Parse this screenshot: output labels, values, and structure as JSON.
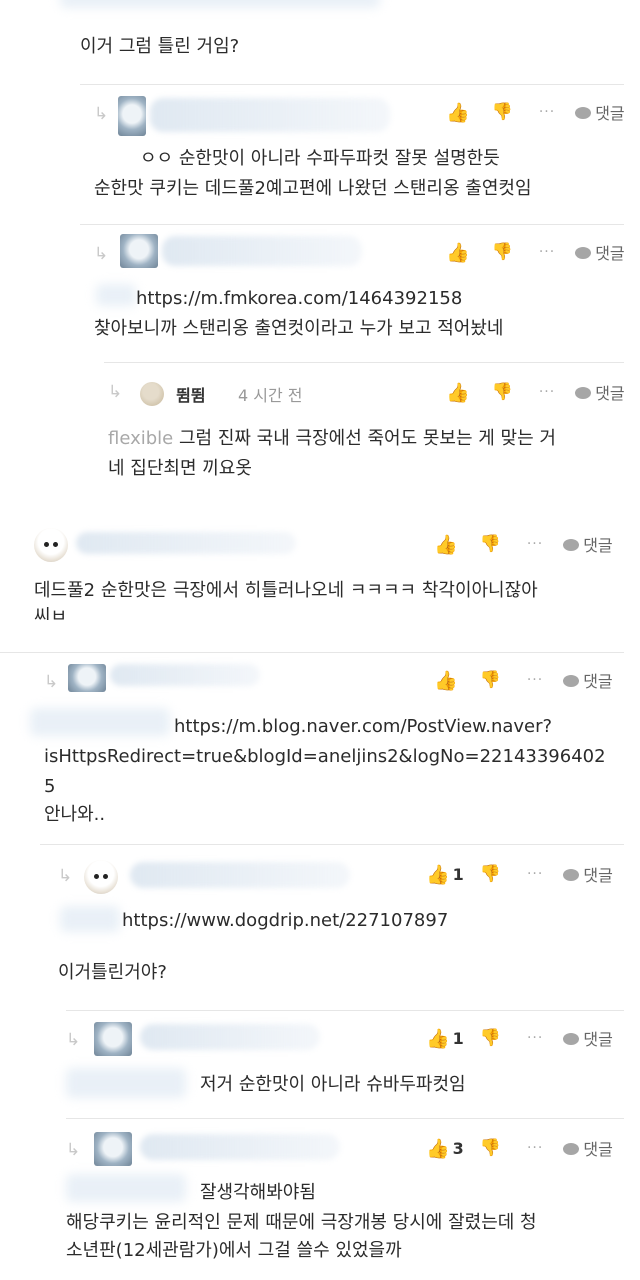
{
  "labels": {
    "reply": "댓글",
    "more": "···"
  },
  "comments": [
    {
      "id": "c0",
      "text_lines": [
        "이거 그럼 틀린 거임?"
      ]
    },
    {
      "id": "c1",
      "likes": "",
      "text_lines": [
        "ㅇㅇ 순한맛이 아니라 수파두파컷 잘못 설명한듯",
        "순한맛 쿠키는 데드풀2예고편에 나왔던 스탠리옹 출연컷임"
      ]
    },
    {
      "id": "c2",
      "likes": "",
      "text_lines": [
        "https://m.fmkorea.com/1464392158",
        "찾아보니까 스탠리옹 출연컷이라고 누가 보고 적어놨네"
      ]
    },
    {
      "id": "c3",
      "author": "뜀뜀",
      "time": "4 시간 전",
      "likes": "",
      "prefix": "flexible",
      "text_lines": [
        "그럼 진짜 국내 극장에선 죽어도 못보는 게 맞는 거",
        "네 집단최면 끼요옷"
      ]
    },
    {
      "id": "c4",
      "likes": "",
      "text_lines": [
        "데드풀2 순한맛은 극장에서 히틀러나오네 ㅋㅋㅋㅋ 착각이아니잖아",
        "씨ㅂ"
      ]
    },
    {
      "id": "c5",
      "likes": "",
      "text_lines": [
        "https://m.blog.naver.com/PostView.naver?",
        "isHttpsRedirect=true&blogId=aneljins2&logNo=22143396402",
        "5",
        "안나와.."
      ]
    },
    {
      "id": "c6",
      "likes": "1",
      "text_lines": [
        "https://www.dogdrip.net/227107897",
        "이거틀린거야?"
      ]
    },
    {
      "id": "c7",
      "likes": "1",
      "text_lines": [
        "저거 순한맛이 아니라 슈바두파컷임"
      ]
    },
    {
      "id": "c8",
      "likes": "3",
      "text_lines": [
        "잘생각해봐야됨",
        "해당쿠키는 윤리적인 문제 때문에 극장개봉 당시에 잘렸는데 청",
        "소년판(12세관람가)에서 그걸 쓸수 있었을까"
      ]
    }
  ]
}
